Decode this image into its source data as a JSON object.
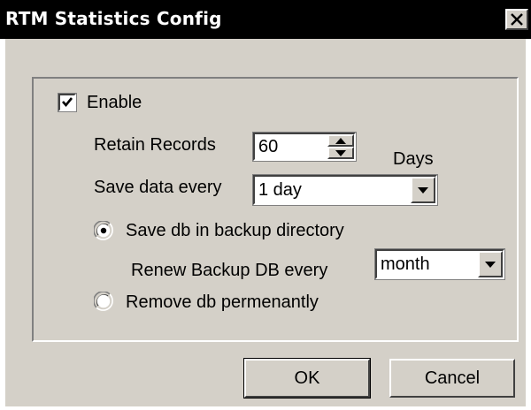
{
  "window": {
    "title": "RTM Statistics Config",
    "close_icon": "close-icon"
  },
  "enable": {
    "label": "Enable",
    "checked": true
  },
  "retain_records": {
    "label": "Retain Records",
    "value": "60",
    "unit": "Days"
  },
  "save_data": {
    "label": "Save data every",
    "selected": "1 day"
  },
  "storage_mode": {
    "options": [
      {
        "label": "Save db in backup directory",
        "selected": true
      },
      {
        "label": "Remove db permenantly",
        "selected": false
      }
    ]
  },
  "renew_backup": {
    "label": "Renew Backup DB every",
    "selected": "month"
  },
  "buttons": {
    "ok": "OK",
    "cancel": "Cancel"
  },
  "colors": {
    "titlebar": "#000000",
    "face": "#d4d0c8"
  }
}
